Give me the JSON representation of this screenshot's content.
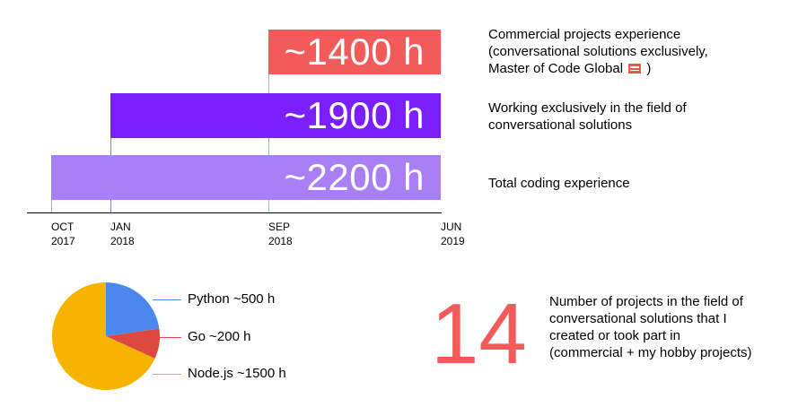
{
  "chart_data": [
    {
      "type": "bar",
      "orientation": "horizontal-timeline",
      "xlabel": "",
      "ylabel": "",
      "grid": false,
      "x_ticks": [
        {
          "line1": "OCT",
          "line2": "2017"
        },
        {
          "line1": "JAN",
          "line2": "2018"
        },
        {
          "line1": "SEP",
          "line2": "2018"
        },
        {
          "line1": "JUN",
          "line2": "2019"
        }
      ],
      "xlim": [
        "2017-10",
        "2019-06"
      ],
      "bars": [
        {
          "label": "~1400 h",
          "hours": 1400,
          "start": "2018-09",
          "end": "2019-06",
          "color": "#f35b5b"
        },
        {
          "label": "~1900 h",
          "hours": 1900,
          "start": "2018-01",
          "end": "2019-06",
          "color": "#7b1fff"
        },
        {
          "label": "~2200 h",
          "hours": 2200,
          "start": "2017-10",
          "end": "2019-06",
          "color": "#a87ff5"
        }
      ],
      "descriptions": [
        {
          "lines": [
            "Commercial projects experience",
            "(conversational solutions exclusively,",
            "Master of Code Global",
            " )"
          ]
        },
        {
          "lines": [
            "Working exclusively in the field of",
            "conversational solutions"
          ]
        },
        {
          "lines": [
            "Total coding experience"
          ]
        }
      ]
    },
    {
      "type": "pie",
      "slices": [
        {
          "label": "Python ~500 h",
          "value": 500,
          "color": "#4c87ee"
        },
        {
          "label": "Go ~200 h",
          "value": 200,
          "color": "#dc4a3f"
        },
        {
          "label": "Node.js ~1500 h",
          "value": 1500,
          "color": "#f6b400"
        }
      ]
    }
  ],
  "projects": {
    "count": "14",
    "count_color": "#f55a5a",
    "lines": [
      "Number of projects in the field of",
      "conversational solutions that I",
      "created or took part in",
      "(commercial + my hobby projects)"
    ]
  }
}
